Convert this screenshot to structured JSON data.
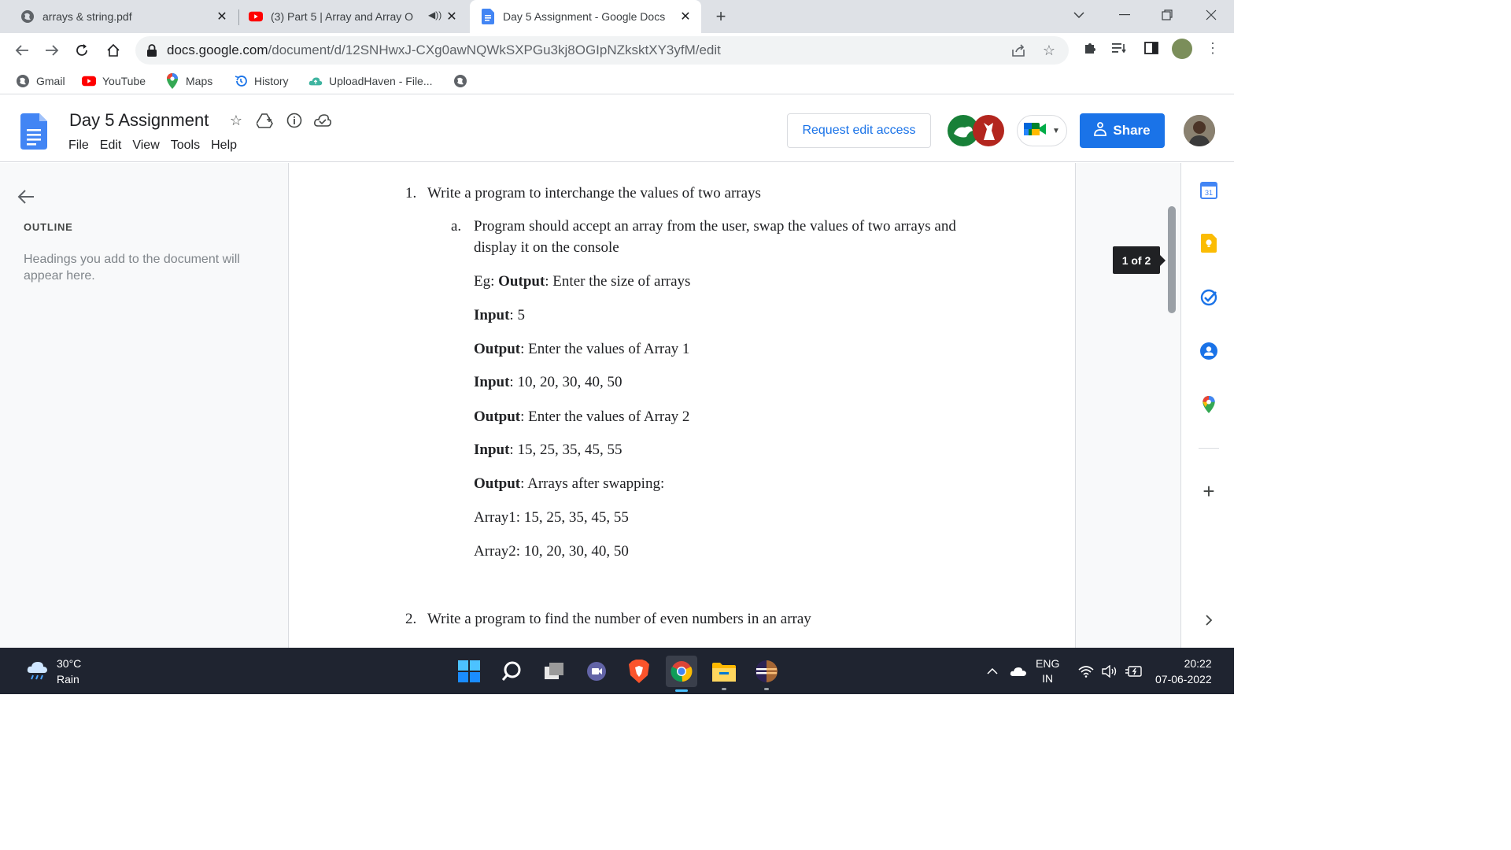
{
  "browser": {
    "tabs": [
      {
        "title": "arrays & string.pdf",
        "icon": "globe-icon"
      },
      {
        "title": "(3) Part 5 | Array and Array O",
        "icon": "youtube-icon"
      },
      {
        "title": "Day 5 Assignment - Google Docs",
        "icon": "docs-icon"
      }
    ],
    "new_tab": "+",
    "url_domain": "docs.google.com",
    "url_path": "/document/d/12SNHwxJ-CXg0awNQWkSXPGu3kj8OGIpNZksktXY3yfM/edit",
    "bookmarks": [
      {
        "label": "Gmail",
        "icon": "globe-icon"
      },
      {
        "label": "YouTube",
        "icon": "youtube-icon"
      },
      {
        "label": "Maps",
        "icon": "maps-pin-icon"
      },
      {
        "label": "History",
        "icon": "history-icon"
      },
      {
        "label": "UploadHaven - File...",
        "icon": "uploadhaven-icon"
      }
    ]
  },
  "docs": {
    "title": "Day 5 Assignment",
    "menu": [
      "File",
      "Edit",
      "View",
      "Tools",
      "Help"
    ],
    "request_edit": "Request edit access",
    "share": "Share",
    "outline_heading": "OUTLINE",
    "outline_hint": "Headings you add to the document will appear here.",
    "page_indicator": "1 of 2",
    "calendar_day": "31"
  },
  "document": {
    "q1_num": "1.",
    "q1_text": "Write a program to interchange the values of two arrays",
    "q1a_letter": "a.",
    "q1a_line1": "Program should accept an array from the user, swap the values of two arrays and",
    "q1a_line2": "display it on the console",
    "eg_prefix": "Eg: ",
    "output_label": "Output",
    "input_label": "Input",
    "l1_text": ": Enter the size of arrays",
    "l2_text": ": 5",
    "l3_text": ": Enter the values of Array 1",
    "l4_text": ": 10, 20, 30, 40, 50",
    "l5_text": ": Enter the values of Array 2",
    "l6_text": ": 15, 25, 35, 45, 55",
    "l7_text": ": Arrays after swapping:",
    "array1": "Array1: 15, 25, 35, 45, 55",
    "array2": "Array2: 10, 20, 30, 40, 50",
    "q2_num": "2.",
    "q2_text": "Write a program to find the number of even numbers in an array"
  },
  "taskbar": {
    "temperature": "30°C",
    "condition": "Rain",
    "language": "ENG",
    "region": "IN",
    "time": "20:22",
    "date": "07-06-2022"
  },
  "colors": {
    "accent": "#1a73e8",
    "tab_strip": "#dee1e6",
    "taskbar": "#1f2430"
  }
}
